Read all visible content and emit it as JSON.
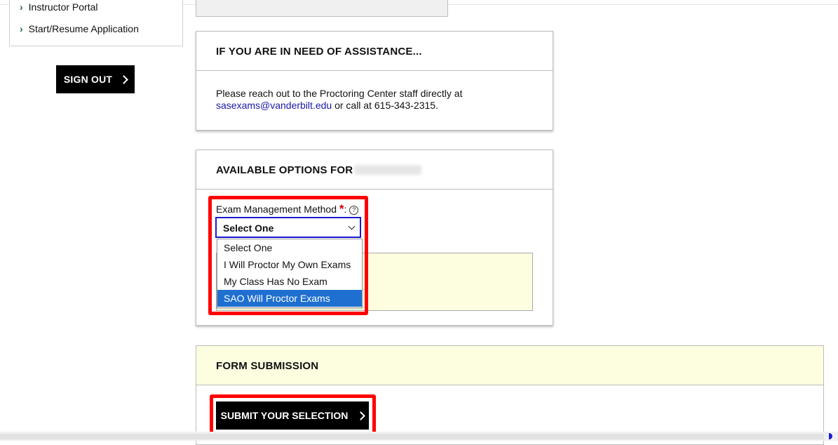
{
  "nav": {
    "items": [
      {
        "label": "Instructor Portal"
      },
      {
        "label": "Start/Resume Application"
      }
    ],
    "sign_out_label": "SIGN OUT"
  },
  "assistance": {
    "title": "IF YOU ARE IN NEED OF ASSISTANCE...",
    "text_before": "Please reach out to the Proctoring Center staff directly at",
    "email": "sasexams@vanderbilt.edu",
    "text_after": " or call at 615-343-2315."
  },
  "options_panel": {
    "title": "AVAILABLE OPTIONS FOR",
    "field_label": "Exam Management Method",
    "required_mark": "*",
    "colon": ":",
    "help_glyph": "?",
    "select_value": "Select One",
    "options": [
      {
        "label": "Select One"
      },
      {
        "label": "I Will Proctor My Own Exams"
      },
      {
        "label": "My Class Has No Exam"
      },
      {
        "label": "SAO Will Proctor Exams"
      }
    ],
    "highlighted_option": "SAO Will Proctor Exams"
  },
  "submission": {
    "title": "FORM SUBMISSION",
    "submit_label": "SUBMIT YOUR SELECTION"
  },
  "colors": {
    "accent_red": "#ff0000",
    "highlight_blue": "#1f6fd1",
    "panel_yellow": "#fdfde0"
  }
}
